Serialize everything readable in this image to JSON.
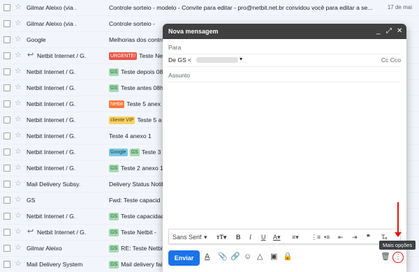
{
  "inbox": {
    "rows": [
      {
        "sender": "Gilmar Aleixo (via .",
        "labels": [],
        "subject": "Controle sorteio - modelo - Convite para editar - pro@netbit.net.br convidou você para editar a se...",
        "date": "17 de mai"
      },
      {
        "sender": "Gilmar Aleixo (via .",
        "labels": [],
        "subject": "Controle sorteio - ",
        "date": ""
      },
      {
        "sender": "Google",
        "labels": [],
        "subject": "Melhorias dos contro",
        "date": ""
      },
      {
        "sender": "Netbit Internet / G.",
        "labels": [
          "URGENTE!"
        ],
        "subject": "Teste Ne",
        "date": ""
      },
      {
        "sender": "Netbit Internet / G.",
        "labels": [
          "GS"
        ],
        "subject": "Teste depois 08",
        "date": ""
      },
      {
        "sender": "Netbit Internet / G.",
        "labels": [
          "GS"
        ],
        "subject": "Teste antes 08h",
        "date": ""
      },
      {
        "sender": "Netbit Internet / G.",
        "labels": [
          "Netbit"
        ],
        "subject": "Teste 5 anex",
        "date": ""
      },
      {
        "sender": "Netbit Internet / G.",
        "labels": [
          "cliente VIP"
        ],
        "subject": "Teste 5 a",
        "date": ""
      },
      {
        "sender": "Netbit Internet / G.",
        "labels": [],
        "subject": "Teste 4 anexo 1",
        "date": ""
      },
      {
        "sender": "Netbit Internet / G.",
        "labels": [
          "Google",
          "GS"
        ],
        "subject": "Teste 3",
        "date": ""
      },
      {
        "sender": "Netbit Internet / G.",
        "labels": [
          "GS"
        ],
        "subject": "Teste 2 anexo 1",
        "date": ""
      },
      {
        "sender": "Mail Delivery Subsy.",
        "labels": [],
        "subject": "Delivery Status Notif",
        "date": ""
      },
      {
        "sender": "GS",
        "labels": [],
        "subject": "Fwd: Teste capacid",
        "date": ""
      },
      {
        "sender": "Netbit Internet / G.",
        "labels": [
          "GS"
        ],
        "subject": "Teste capacidad",
        "date": ""
      },
      {
        "sender": "Netbit Internet / G.",
        "labels": [
          "GS"
        ],
        "subject": "Teste Netbit - ",
        "date": ""
      },
      {
        "sender": "Gilmar Aleixo",
        "labels": [
          "GS"
        ],
        "subject": "RE: Teste Netbit",
        "date": ""
      },
      {
        "sender": "Mail Delivery System",
        "labels": [
          "GS"
        ],
        "subject": "Mail delivery fai",
        "date": ""
      }
    ]
  },
  "compose": {
    "title": "Nova mensagem",
    "to_label": "Para",
    "from_label": "De GS <",
    "cc_label": "Cc Cco",
    "subject_placeholder": "Assunto",
    "font_name": "Sans Serif",
    "send_label": "Enviar"
  },
  "tooltip": "Mais opções"
}
